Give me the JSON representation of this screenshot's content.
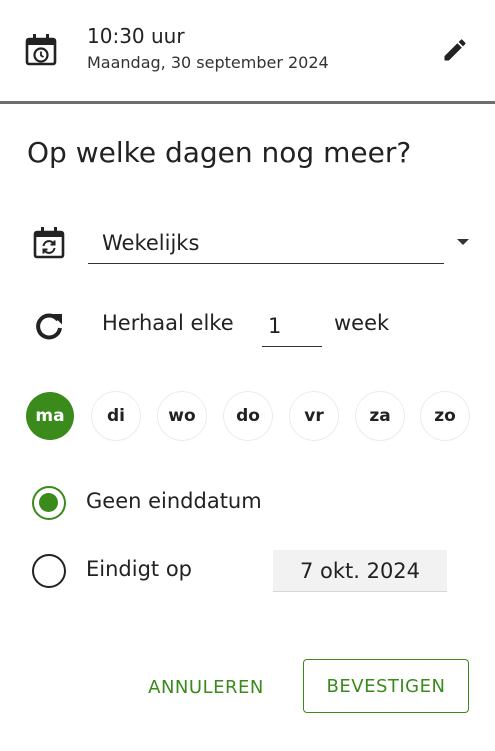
{
  "header": {
    "time": "10:30 uur",
    "date": "Maandag, 30 september 2024",
    "icon": "calendar-clock-icon",
    "edit_icon": "pencil-icon"
  },
  "question": "Op welke dagen nog meer?",
  "frequency": {
    "icon": "calendar-sync-icon",
    "selected": "Wekelijks"
  },
  "repeat": {
    "icon": "refresh-icon",
    "label": "Herhaal elke",
    "value": "1",
    "unit": "week"
  },
  "days": [
    {
      "label": "ma",
      "selected": true
    },
    {
      "label": "di",
      "selected": false
    },
    {
      "label": "wo",
      "selected": false
    },
    {
      "label": "do",
      "selected": false
    },
    {
      "label": "vr",
      "selected": false
    },
    {
      "label": "za",
      "selected": false
    },
    {
      "label": "zo",
      "selected": false
    }
  ],
  "end": {
    "option_none": "Geen einddatum",
    "option_until": "Eindigt op",
    "until_date": "7 okt. 2024",
    "selected": "none"
  },
  "actions": {
    "cancel": "ANNULEREN",
    "confirm": "BEVESTIGEN"
  },
  "colors": {
    "accent": "#3a8a1c",
    "divider": "#6e6e6e",
    "text": "#222222"
  }
}
